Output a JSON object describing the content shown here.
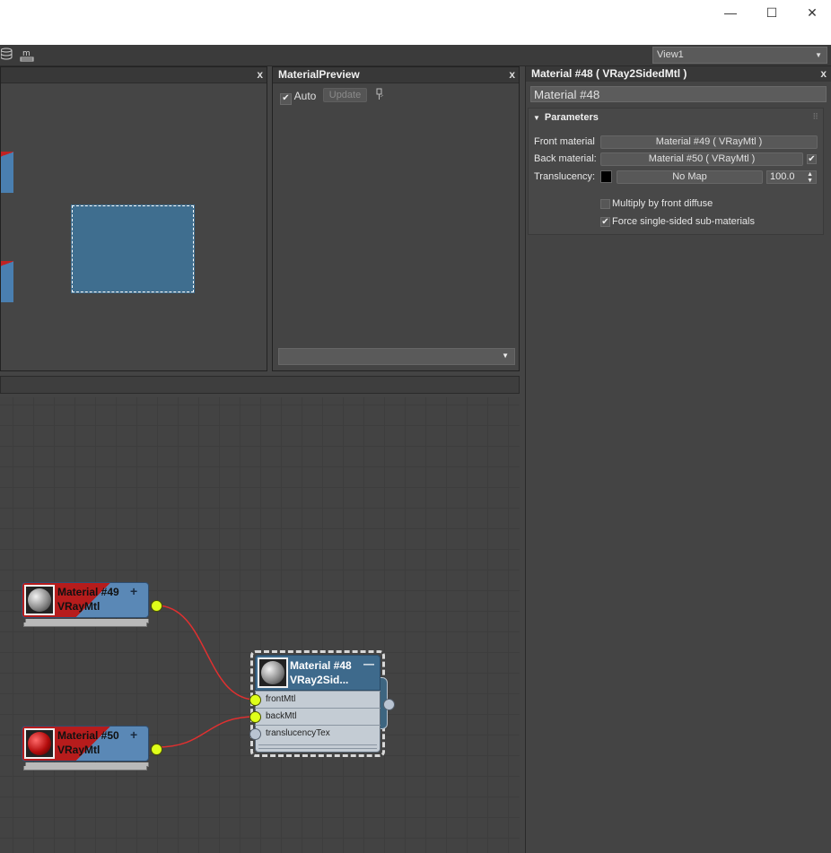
{
  "window": {
    "min_glyph": "—",
    "max_glyph": "☐",
    "close_glyph": "✕"
  },
  "toolbar": {
    "view_select": "View1"
  },
  "nav_panel": {
    "close_glyph": "x"
  },
  "preview_panel": {
    "title": "MaterialPreview",
    "close_glyph": "x",
    "auto_label": "Auto",
    "auto_checked": true,
    "update_label": "Update"
  },
  "right_panel": {
    "title": "Material #48  ( VRay2SidedMtl )",
    "close_glyph": "x",
    "material_name": "Material #48",
    "rollout_title": "Parameters",
    "front_label": "Front material",
    "front_value": "Material #49  ( VRayMtl )",
    "back_label": "Back material:",
    "back_value": "Material #50  ( VRayMtl )",
    "back_enabled": true,
    "translucency_label": "Translucency:",
    "translucency_color": "#000000",
    "translucency_map": "No Map",
    "translucency_amount": "100.0",
    "multiply_label": "Multiply by front diffuse",
    "multiply_checked": false,
    "force_label": "Force single-sided sub-materials",
    "force_checked": true
  },
  "graph": {
    "node49": {
      "name": "Material #49",
      "type": "VRayMtl",
      "expand_glyph": "+"
    },
    "node50": {
      "name": "Material #50",
      "type": "VRayMtl",
      "expand_glyph": "+"
    },
    "node48": {
      "name": "Material #48",
      "type": "VRay2Sid...",
      "collapse_glyph": "—",
      "slots": [
        "frontMtl",
        "backMtl",
        "translucencyTex"
      ]
    }
  },
  "colors": {
    "node_blue": "#5a88b6",
    "node_red": "#b61c1c",
    "socket_connected": "#dfff1a",
    "socket_empty": "#b9c4d2",
    "wire": "#e03030"
  }
}
